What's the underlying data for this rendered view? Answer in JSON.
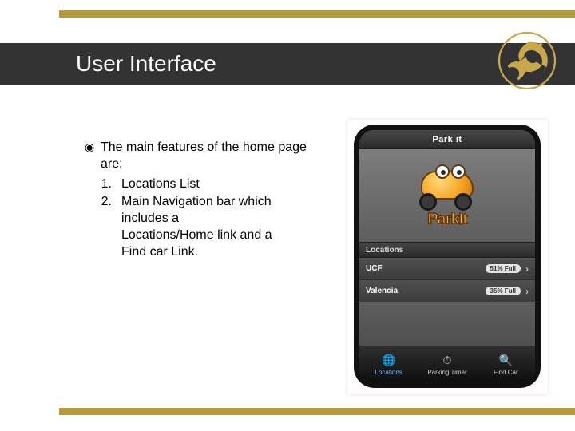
{
  "slide": {
    "title": "User Interface",
    "bullet_lead": "The main features of the home page are:",
    "list": [
      "Locations List",
      "Main Navigation bar which includes a Locations/Home link and a Find car Link."
    ]
  },
  "phone": {
    "header": "Park it",
    "brand": "ParkIt",
    "section": "Locations",
    "rows": [
      {
        "name": "UCF",
        "fill": "51% Full"
      },
      {
        "name": "Valencia",
        "fill": "35% Full"
      }
    ],
    "tabs": [
      {
        "label": "Locations",
        "active": true
      },
      {
        "label": "Parking Timer",
        "active": false
      },
      {
        "label": "Find Car",
        "active": false
      }
    ]
  }
}
